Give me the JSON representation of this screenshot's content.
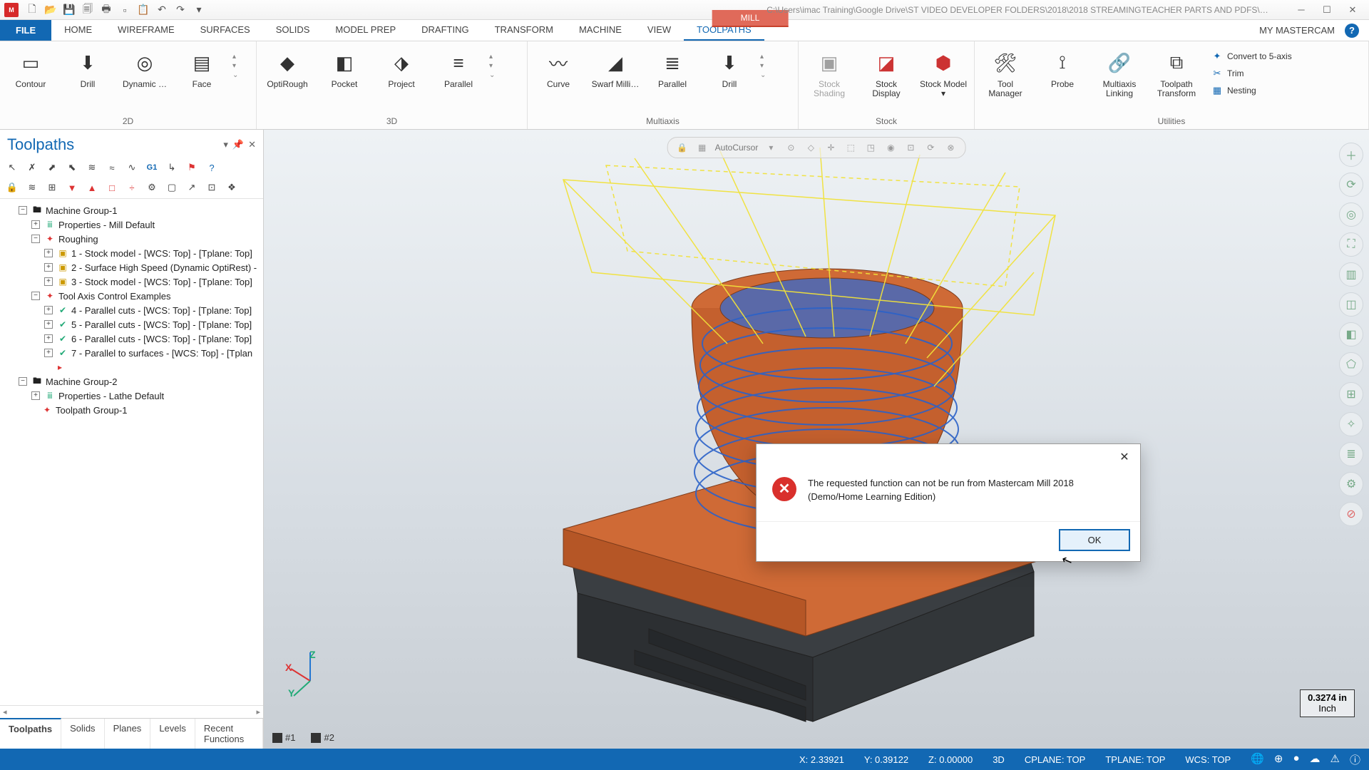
{
  "title": {
    "context_tab": "MILL",
    "path": "C:\\Users\\imac Training\\Google Drive\\ST VIDEO DEVELOPER FOLDERS\\2018\\2018 STREAMINGTEACHER PARTS AND PDFS\\1…"
  },
  "tabs": {
    "file": "FILE",
    "items": [
      "HOME",
      "WIREFRAME",
      "SURFACES",
      "SOLIDS",
      "MODEL PREP",
      "DRAFTING",
      "TRANSFORM",
      "MACHINE",
      "VIEW",
      "TOOLPATHS"
    ],
    "active_index": 9,
    "my_mastercam": "MY MASTERCAM"
  },
  "ribbon": {
    "g2d": {
      "label": "2D",
      "items": [
        "Contour",
        "Drill",
        "Dynamic …",
        "Face"
      ]
    },
    "g3d": {
      "label": "3D",
      "items": [
        "OptiRough",
        "Pocket",
        "Project",
        "Parallel"
      ]
    },
    "multiaxis": {
      "label": "Multiaxis",
      "items": [
        "Curve",
        "Swarf Milli…",
        "Parallel",
        "Drill"
      ]
    },
    "stock": {
      "label": "Stock",
      "items": [
        "Stock Shading",
        "Stock Display",
        "Stock Model ▾"
      ]
    },
    "utilities": {
      "label": "Utilities",
      "items": [
        "Tool Manager",
        "Probe",
        "Multiaxis Linking",
        "Toolpath Transform"
      ],
      "side": [
        "Convert to 5-axis",
        "Trim",
        "Nesting"
      ]
    }
  },
  "panel": {
    "title": "Toolpaths",
    "bottom_tabs": [
      "Toolpaths",
      "Solids",
      "Planes",
      "Levels",
      "Recent Functions"
    ],
    "active_bottom": 0
  },
  "tree": {
    "mg1": "Machine Group-1",
    "mg1_props": "Properties - Mill Default",
    "roughing": "Roughing",
    "r1": "1 - Stock model - [WCS: Top] - [Tplane: Top]",
    "r2": "2 - Surface High Speed (Dynamic OptiRest) - ",
    "r3": "3 - Stock model - [WCS: Top] - [Tplane: Top]",
    "tac": "Tool Axis Control Examples",
    "t4": "4 - Parallel cuts - [WCS: Top] - [Tplane: Top]",
    "t5": "5 - Parallel cuts - [WCS: Top] - [Tplane: Top]",
    "t6": "6 - Parallel cuts - [WCS: Top] - [Tplane: Top]",
    "t7": "7 - Parallel to surfaces - [WCS: Top] - [Tplan",
    "mg2": "Machine Group-2",
    "mg2_props": "Properties - Lathe Default",
    "tpg1": "Toolpath Group-1"
  },
  "viewport": {
    "autocursor": "AutoCursor",
    "scale_value": "0.3274 in",
    "scale_unit": "Inch",
    "tabs": [
      "#1",
      "#2"
    ],
    "axes": {
      "x": "X",
      "y": "Y",
      "z": "Z"
    }
  },
  "dialog": {
    "line1": "The requested function can not be run from Mastercam Mill 2018",
    "line2": "(Demo/Home Learning Edition)",
    "ok": "OK"
  },
  "status": {
    "x": "X:   2.33921",
    "y": "Y:   0.39122",
    "z": "Z:   0.00000",
    "mode": "3D",
    "cplane": "CPLANE: TOP",
    "tplane": "TPLANE: TOP",
    "wcs": "WCS: TOP"
  }
}
